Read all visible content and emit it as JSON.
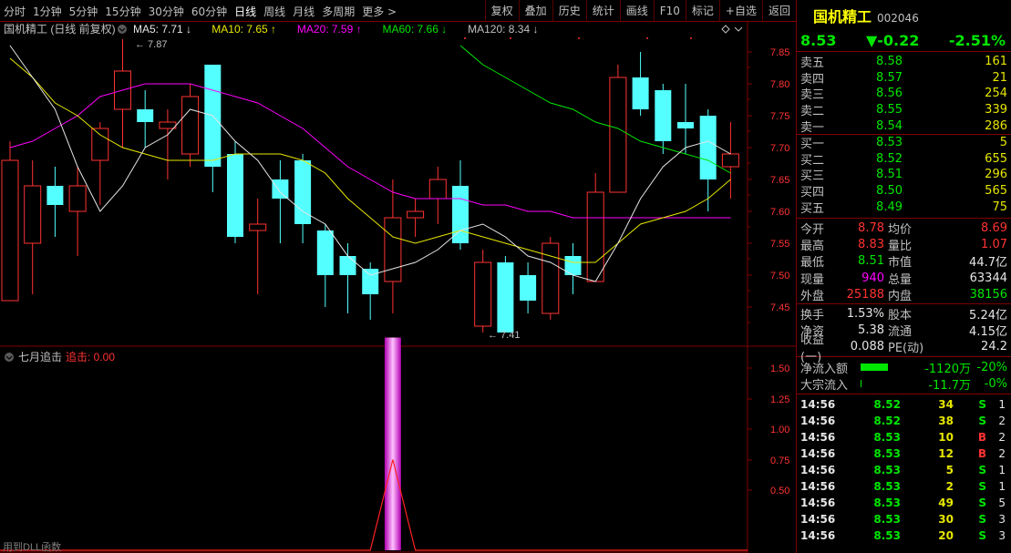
{
  "toolbar": {
    "periods": [
      "分时",
      "1分钟",
      "5分钟",
      "15分钟",
      "30分钟",
      "60分钟",
      "日线",
      "周线",
      "月线",
      "多周期",
      "更多 >"
    ],
    "active_period": "日线",
    "tools": [
      "复权",
      "叠加",
      "历史",
      "统计",
      "画线",
      "F10",
      "标记",
      "+自选",
      "返回"
    ]
  },
  "main_chart": {
    "title": "国机精工 (日线 前复权)",
    "ma_labels": [
      {
        "name": "MA5",
        "value": "7.71",
        "arrow": "↓",
        "color": "#e6e6e6"
      },
      {
        "name": "MA10",
        "value": "7.65",
        "arrow": "↑",
        "color": "#e6e600"
      },
      {
        "name": "MA20",
        "value": "7.59",
        "arrow": "↑",
        "color": "#ff00ff"
      },
      {
        "name": "MA60",
        "value": "7.66",
        "arrow": "↓",
        "color": "#00e600"
      },
      {
        "name": "MA120",
        "value": "8.34",
        "arrow": "↓",
        "color": "#c0c0c0"
      }
    ],
    "high_mark": "7.87",
    "low_mark": "7.41",
    "y_ticks": [
      "7.85",
      "7.80",
      "7.75",
      "7.70",
      "7.65",
      "7.60",
      "7.55",
      "7.50",
      "7.45"
    ]
  },
  "indicator": {
    "title": "七月追击",
    "param_label": "追击",
    "param_value": "0.00",
    "y_ticks": [
      "1.50",
      "1.25",
      "1.00",
      "0.75",
      "0.50"
    ],
    "footer": "用到DLL函数"
  },
  "chart_data": [
    {
      "type": "candlestick",
      "title": "国机精工 (日线 前复权)",
      "ylim": [
        7.4,
        7.9
      ],
      "candles": [
        {
          "o": 7.46,
          "c": 7.68,
          "h": 7.71,
          "l": 7.46
        },
        {
          "o": 7.55,
          "c": 7.64,
          "h": 7.68,
          "l": 7.47
        },
        {
          "o": 7.64,
          "c": 7.61,
          "h": 7.67,
          "l": 7.56
        },
        {
          "o": 7.6,
          "c": 7.64,
          "h": 7.67,
          "l": 7.53
        },
        {
          "o": 7.68,
          "c": 7.73,
          "h": 7.74,
          "l": 7.61
        },
        {
          "o": 7.76,
          "c": 7.82,
          "h": 7.87,
          "l": 7.7
        },
        {
          "o": 7.76,
          "c": 7.74,
          "h": 7.79,
          "l": 7.7
        },
        {
          "o": 7.73,
          "c": 7.74,
          "h": 7.76,
          "l": 7.65
        },
        {
          "o": 7.69,
          "c": 7.78,
          "h": 7.8,
          "l": 7.67
        },
        {
          "o": 7.83,
          "c": 7.67,
          "h": 7.83,
          "l": 7.63
        },
        {
          "o": 7.69,
          "c": 7.56,
          "h": 7.71,
          "l": 7.55
        },
        {
          "o": 7.57,
          "c": 7.58,
          "h": 7.62,
          "l": 7.47
        },
        {
          "o": 7.65,
          "c": 7.62,
          "h": 7.68,
          "l": 7.55
        },
        {
          "o": 7.68,
          "c": 7.58,
          "h": 7.69,
          "l": 7.55
        },
        {
          "o": 7.57,
          "c": 7.5,
          "h": 7.58,
          "l": 7.45
        },
        {
          "o": 7.53,
          "c": 7.5,
          "h": 7.55,
          "l": 7.44
        },
        {
          "o": 7.51,
          "c": 7.47,
          "h": 7.52,
          "l": 7.43
        },
        {
          "o": 7.49,
          "c": 7.59,
          "h": 7.65,
          "l": 7.44
        },
        {
          "o": 7.59,
          "c": 7.6,
          "h": 7.62,
          "l": 7.56
        },
        {
          "o": 7.62,
          "c": 7.65,
          "h": 7.67,
          "l": 7.58
        },
        {
          "o": 7.64,
          "c": 7.55,
          "h": 7.68,
          "l": 7.54
        },
        {
          "o": 7.42,
          "c": 7.52,
          "h": 7.54,
          "l": 7.41
        },
        {
          "o": 7.52,
          "c": 7.41,
          "h": 7.53,
          "l": 7.41
        },
        {
          "o": 7.5,
          "c": 7.46,
          "h": 7.52,
          "l": 7.44
        },
        {
          "o": 7.44,
          "c": 7.55,
          "h": 7.56,
          "l": 7.43
        },
        {
          "o": 7.53,
          "c": 7.5,
          "h": 7.55,
          "l": 7.47
        },
        {
          "o": 7.49,
          "c": 7.63,
          "h": 7.66,
          "l": 7.49
        },
        {
          "o": 7.63,
          "c": 7.81,
          "h": 7.83,
          "l": 7.63
        },
        {
          "o": 7.81,
          "c": 7.76,
          "h": 7.85,
          "l": 7.75
        },
        {
          "o": 7.79,
          "c": 7.71,
          "h": 7.8,
          "l": 7.69
        },
        {
          "o": 7.74,
          "c": 7.73,
          "h": 7.8,
          "l": 7.69
        },
        {
          "o": 7.75,
          "c": 7.65,
          "h": 7.76,
          "l": 7.6
        },
        {
          "o": 7.67,
          "c": 7.69,
          "h": 7.74,
          "l": 7.62
        }
      ],
      "ma5": [
        7.86,
        7.81,
        7.76,
        7.67,
        7.6,
        7.64,
        7.7,
        7.72,
        7.76,
        7.75,
        7.71,
        7.68,
        7.63,
        7.6,
        7.58,
        7.53,
        7.5,
        7.51,
        7.52,
        7.54,
        7.57,
        7.58,
        7.56,
        7.53,
        7.52,
        7.5,
        7.49,
        7.55,
        7.62,
        7.67,
        7.7,
        7.71,
        7.69
      ],
      "ma10": [
        7.84,
        7.81,
        7.77,
        7.75,
        7.72,
        7.7,
        7.69,
        7.68,
        7.68,
        7.68,
        7.69,
        7.69,
        7.69,
        7.68,
        7.66,
        7.62,
        7.59,
        7.56,
        7.55,
        7.56,
        7.57,
        7.56,
        7.55,
        7.54,
        7.53,
        7.52,
        7.52,
        7.55,
        7.58,
        7.59,
        7.6,
        7.62,
        7.65
      ],
      "ma20": [
        7.7,
        7.71,
        7.73,
        7.75,
        7.78,
        7.79,
        7.8,
        7.8,
        7.8,
        7.79,
        7.78,
        7.77,
        7.75,
        7.73,
        7.7,
        7.67,
        7.65,
        7.63,
        7.62,
        7.62,
        7.62,
        7.61,
        7.61,
        7.6,
        7.6,
        7.59,
        7.59,
        7.59,
        7.59,
        7.59,
        7.59,
        7.59,
        7.59
      ],
      "ma60": [
        null,
        null,
        null,
        null,
        null,
        null,
        null,
        null,
        null,
        null,
        null,
        null,
        null,
        null,
        null,
        null,
        null,
        null,
        null,
        null,
        7.86,
        7.83,
        7.81,
        7.79,
        7.77,
        7.76,
        7.74,
        7.73,
        7.71,
        7.7,
        7.69,
        7.68,
        7.66
      ]
    },
    {
      "type": "bar",
      "title": "七月追击",
      "ylim": [
        0,
        1.75
      ],
      "values": [
        0,
        0,
        0,
        0,
        0,
        0,
        0,
        0,
        0,
        0,
        0,
        0,
        0,
        0,
        0,
        0,
        0,
        1.75,
        0,
        0,
        0,
        0,
        0,
        0,
        0,
        0,
        0,
        0,
        0,
        0,
        0,
        0,
        0
      ],
      "line": [
        0,
        0,
        0,
        0,
        0,
        0,
        0,
        0,
        0,
        0,
        0,
        0,
        0,
        0,
        0,
        0,
        0,
        0.75,
        0,
        0,
        0,
        0,
        0,
        0,
        0,
        0,
        0,
        0,
        0,
        0,
        0,
        0,
        0
      ]
    }
  ],
  "quote": {
    "name": "国机精工",
    "code": "002046",
    "price": "8.53",
    "change": "▼-0.22",
    "change_pct": "-2.51%",
    "asks": [
      {
        "label": "卖五",
        "price": "8.58",
        "vol": "161"
      },
      {
        "label": "卖四",
        "price": "8.57",
        "vol": "21"
      },
      {
        "label": "卖三",
        "price": "8.56",
        "vol": "254"
      },
      {
        "label": "卖二",
        "price": "8.55",
        "vol": "339"
      },
      {
        "label": "卖一",
        "price": "8.54",
        "vol": "286"
      }
    ],
    "bids": [
      {
        "label": "买一",
        "price": "8.53",
        "vol": "5"
      },
      {
        "label": "买二",
        "price": "8.52",
        "vol": "655"
      },
      {
        "label": "买三",
        "price": "8.51",
        "vol": "296"
      },
      {
        "label": "买四",
        "price": "8.50",
        "vol": "565"
      },
      {
        "label": "买五",
        "price": "8.49",
        "vol": "75"
      }
    ],
    "stats1": [
      {
        "l1": "今开",
        "v1": "8.78",
        "c1": "r",
        "l2": "均价",
        "v2": "8.69",
        "c2": "r"
      },
      {
        "l1": "最高",
        "v1": "8.83",
        "c1": "r",
        "l2": "量比",
        "v2": "1.07",
        "c2": "r"
      },
      {
        "l1": "最低",
        "v1": "8.51",
        "c1": "g",
        "l2": "市值",
        "v2": "44.7亿",
        "c2": "w"
      },
      {
        "l1": "现量",
        "v1": "940",
        "c1": "m",
        "l2": "总量",
        "v2": "63344",
        "c2": "w"
      },
      {
        "l1": "外盘",
        "v1": "25188",
        "c1": "r",
        "l2": "内盘",
        "v2": "38156",
        "c2": "g"
      }
    ],
    "stats2": [
      {
        "l1": "换手",
        "v1": "1.53%",
        "c1": "w",
        "l2": "股本",
        "v2": "5.24亿",
        "c2": "w"
      },
      {
        "l1": "净资",
        "v1": "5.38",
        "c1": "w",
        "l2": "流通",
        "v2": "4.15亿",
        "c2": "w"
      },
      {
        "l1": "收益(一)",
        "v1": "0.088",
        "c1": "w",
        "l2": "PE(动)",
        "v2": "24.2",
        "c2": "w"
      }
    ],
    "flow": [
      {
        "label": "净流入额",
        "amount": "-1120万",
        "pct": "-20%",
        "bar": 0.5
      },
      {
        "label": "大宗流入",
        "amount": "-11.7万",
        "pct": "-0%",
        "bar": 0.01
      }
    ],
    "ticks": [
      {
        "t": "14:56",
        "p": "8.52",
        "v": "34",
        "d": "S",
        "n": "1"
      },
      {
        "t": "14:56",
        "p": "8.52",
        "v": "38",
        "d": "S",
        "n": "2"
      },
      {
        "t": "14:56",
        "p": "8.53",
        "v": "10",
        "d": "B",
        "n": "2"
      },
      {
        "t": "14:56",
        "p": "8.53",
        "v": "12",
        "d": "B",
        "n": "2"
      },
      {
        "t": "14:56",
        "p": "8.53",
        "v": "5",
        "d": "S",
        "n": "1"
      },
      {
        "t": "14:56",
        "p": "8.53",
        "v": "2",
        "d": "S",
        "n": "1"
      },
      {
        "t": "14:56",
        "p": "8.53",
        "v": "49",
        "d": "S",
        "n": "5"
      },
      {
        "t": "14:56",
        "p": "8.53",
        "v": "30",
        "d": "S",
        "n": "3"
      },
      {
        "t": "14:56",
        "p": "8.53",
        "v": "20",
        "d": "S",
        "n": "3"
      }
    ]
  }
}
